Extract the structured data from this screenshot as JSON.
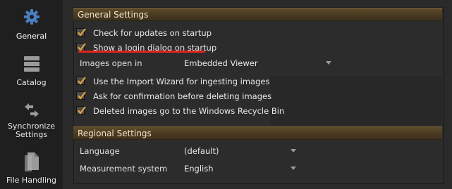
{
  "sidebar": {
    "items": [
      {
        "label": "General",
        "icon": "gear-icon",
        "active": true
      },
      {
        "label": "Catalog",
        "icon": "catalog-stack-icon",
        "active": false
      },
      {
        "label": "Synchronize\nSettings",
        "label_line1": "Synchronize",
        "label_line2": "Settings",
        "icon": "sync-arrows-icon",
        "active": false
      },
      {
        "label": "File Handling",
        "icon": "file-icon",
        "active": false
      }
    ]
  },
  "general_settings": {
    "title": "General Settings",
    "check_updates": {
      "label": "Check for updates on startup",
      "checked": true
    },
    "login_dialog": {
      "label": "Show a login dialog on startup",
      "checked": true
    },
    "images_open_in": {
      "label": "Images open in",
      "value": "Embedded Viewer"
    },
    "import_wizard": {
      "label": "Use the Import Wizard for ingesting images",
      "checked": true
    },
    "confirm_delete": {
      "label": "Ask for confirmation before deleting images",
      "checked": true
    },
    "recycle_bin": {
      "label": "Deleted images go to the Windows Recycle Bin",
      "checked": true
    }
  },
  "regional_settings": {
    "title": "Regional Settings",
    "language": {
      "label": "Language",
      "value": "(default)"
    },
    "measurement": {
      "label": "Measurement system",
      "value": "English"
    }
  },
  "colors": {
    "accent_gear": "#4a7fc1",
    "check_mark": "#e8a43a",
    "header_gold": "#5e4c2c",
    "highlight_underline": "#e0241b"
  }
}
